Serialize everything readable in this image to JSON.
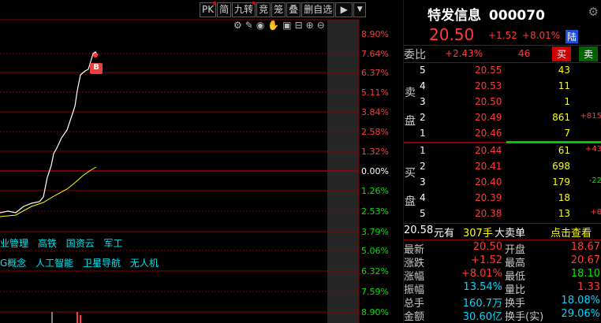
{
  "toolbar": {
    "buttons": [
      "PK",
      "简",
      "九转",
      "竞",
      "笼",
      "叠",
      "删自选"
    ],
    "nav_icon": "jump-to-end-icon",
    "menu_icon": "dropdown-icon"
  },
  "chart": {
    "tool_icons": [
      "settings-icon",
      "pen-icon",
      "eye-icon",
      "hand-icon",
      "save-icon",
      "fold-icon",
      "zoom-in-icon",
      "zoom-out-icon"
    ],
    "pct_labels": [
      "8.90%",
      "7.64%",
      "6.37%",
      "5.11%",
      "3.84%",
      "2.58%",
      "1.32%",
      "0.00%",
      "1.26%",
      "2.53%",
      "3.79%",
      "5.06%",
      "6.32%",
      "7.59%",
      "8.90%"
    ],
    "buy_marker": "B",
    "concept_tags_1": [
      "业管理",
      "高铁",
      "国资云",
      "军工"
    ],
    "concept_tags_2": [
      "G概念",
      "人工智能",
      "卫星导航",
      "无人机"
    ]
  },
  "quote": {
    "name": "特发信息",
    "code": "000070",
    "price": "20.50",
    "change": "+1.52",
    "change_pct": "+8.01%",
    "market_tag": "陆",
    "weibi_label": "委比",
    "weibi_pct": "+2.43%",
    "weibi_diff": "46",
    "buy_btn": "买",
    "sell_btn": "卖",
    "sell_side_label": [
      "卖",
      "盘"
    ],
    "buy_side_label": [
      "买",
      "盘"
    ],
    "sell_orders": [
      {
        "lvl": "5",
        "price": "20.55",
        "vol": "43",
        "chg": ""
      },
      {
        "lvl": "4",
        "price": "20.53",
        "vol": "11",
        "chg": ""
      },
      {
        "lvl": "3",
        "price": "20.50",
        "vol": "1",
        "chg": ""
      },
      {
        "lvl": "2",
        "price": "20.49",
        "vol": "861",
        "chg": "+815"
      },
      {
        "lvl": "1",
        "price": "20.46",
        "vol": "7",
        "chg": ""
      }
    ],
    "buy_orders": [
      {
        "lvl": "1",
        "price": "20.44",
        "vol": "61",
        "chg": "+43"
      },
      {
        "lvl": "2",
        "price": "20.41",
        "vol": "698",
        "chg": ""
      },
      {
        "lvl": "3",
        "price": "20.40",
        "vol": "179",
        "chg": "-22"
      },
      {
        "lvl": "4",
        "price": "20.39",
        "vol": "18",
        "chg": ""
      },
      {
        "lvl": "5",
        "price": "20.38",
        "vol": "13",
        "chg": "+8"
      }
    ],
    "big_order": {
      "amount": "20.58",
      "unit": "元有",
      "hands": "307手",
      "text": "大卖单",
      "link": "点击查看"
    },
    "stats": [
      {
        "l1": "最新",
        "v1": "20.50",
        "l2": "开盘",
        "v2": "18.67"
      },
      {
        "l1": "涨跌",
        "v1": "+1.52",
        "l2": "最高",
        "v2": "20.67"
      },
      {
        "l1": "涨幅",
        "v1": "+8.01%",
        "l2": "最低",
        "v2": "18.10"
      },
      {
        "l1": "振幅",
        "v1": "13.54%",
        "l2": "量比",
        "v2": "1.33"
      },
      {
        "l1": "总手",
        "v1": "160.7万",
        "l2": "换手",
        "v2": "18.08%"
      },
      {
        "l1": "金额",
        "v1": "30.60亿",
        "l2": "换手(实)",
        "v2": "29.06%"
      }
    ]
  }
}
